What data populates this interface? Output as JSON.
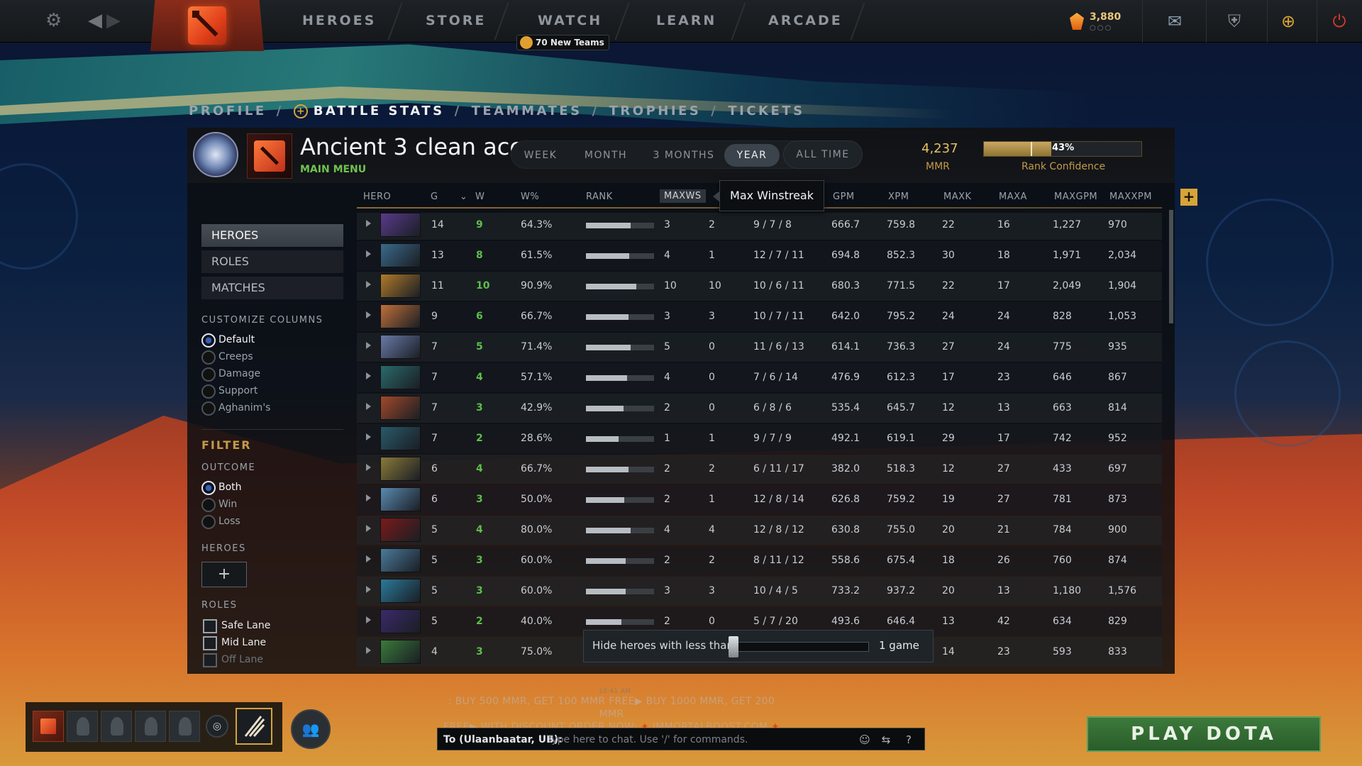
{
  "nav": {
    "items": [
      "HEROES",
      "STORE",
      "WATCH",
      "LEARN",
      "ARCADE"
    ],
    "notification": "70 New Teams",
    "shards": "3,880",
    "shards_sub": "○○○"
  },
  "breadcrumb": {
    "profile": "PROFILE",
    "battle_stats": "BATTLE STATS",
    "teammates": "TEAMMATES",
    "trophies": "TROPHIES",
    "tickets": "TICKETS",
    "sep": "/"
  },
  "profile": {
    "name": "Ancient 3 clean acc",
    "subtitle": "MAIN MENU"
  },
  "timeframe": {
    "options": [
      "WEEK",
      "MONTH",
      "3 MONTHS",
      "YEAR"
    ],
    "selected": "YEAR",
    "all_time": "ALL TIME"
  },
  "mmr": {
    "value": "4,237",
    "label": "MMR"
  },
  "rank_confidence": {
    "percent_label": "43%",
    "fraction": 0.43,
    "label": "Rank Confidence"
  },
  "columns": [
    "HERO",
    "G",
    "W",
    "W%",
    "RANK",
    "MAXWS",
    "GPM",
    "XPM",
    "MAXK",
    "MAXA",
    "MAXGPM",
    "MAXXPM"
  ],
  "tooltip": "Max Winstreak",
  "sidebar": {
    "tabs": [
      "HEROES",
      "ROLES",
      "MATCHES"
    ],
    "customize_title": "CUSTOMIZE COLUMNS",
    "customize_options": [
      "Default",
      "Creeps",
      "Damage",
      "Support",
      "Aghanim's"
    ],
    "filter_title": "FILTER",
    "outcome_title": "OUTCOME",
    "outcome_options": [
      "Both",
      "Win",
      "Loss"
    ],
    "heroes_title": "HEROES",
    "hero_add": "+",
    "roles_title": "ROLES",
    "roles": [
      "Safe Lane",
      "Mid Lane",
      "Off Lane"
    ]
  },
  "rows": [
    {
      "g": "14",
      "w": "9",
      "wp": "64.3%",
      "rank": 0.66,
      "maxws": "3",
      "cur": "2",
      "kda": "9 / 7 / 8",
      "gpm": "666.7",
      "xpm": "759.8",
      "maxk": "22",
      "maxa": "16",
      "maxgpm": "1,227",
      "maxxpm": "970",
      "color": "#5a3a8a"
    },
    {
      "g": "13",
      "w": "8",
      "wp": "61.5%",
      "rank": 0.64,
      "maxws": "4",
      "cur": "1",
      "kda": "12 / 7 / 11",
      "gpm": "694.8",
      "xpm": "852.3",
      "maxk": "30",
      "maxa": "18",
      "maxgpm": "1,971",
      "maxxpm": "2,034",
      "color": "#3a6a8a"
    },
    {
      "g": "11",
      "w": "10",
      "wp": "90.9%",
      "rank": 0.74,
      "maxws": "10",
      "cur": "10",
      "kda": "10 / 6 / 11",
      "gpm": "680.3",
      "xpm": "771.5",
      "maxk": "22",
      "maxa": "17",
      "maxgpm": "2,049",
      "maxxpm": "1,904",
      "color": "#b07a2a"
    },
    {
      "g": "9",
      "w": "6",
      "wp": "66.7%",
      "rank": 0.62,
      "maxws": "3",
      "cur": "3",
      "kda": "10 / 7 / 11",
      "gpm": "642.0",
      "xpm": "795.2",
      "maxk": "24",
      "maxa": "24",
      "maxgpm": "828",
      "maxxpm": "1,053",
      "color": "#c0703a"
    },
    {
      "g": "7",
      "w": "5",
      "wp": "71.4%",
      "rank": 0.66,
      "maxws": "5",
      "cur": "0",
      "kda": "11 / 6 / 13",
      "gpm": "614.1",
      "xpm": "736.3",
      "maxk": "27",
      "maxa": "24",
      "maxgpm": "775",
      "maxxpm": "935",
      "color": "#6a7aa8"
    },
    {
      "g": "7",
      "w": "4",
      "wp": "57.1%",
      "rank": 0.6,
      "maxws": "4",
      "cur": "0",
      "kda": "7 / 6 / 14",
      "gpm": "476.9",
      "xpm": "612.3",
      "maxk": "17",
      "maxa": "23",
      "maxgpm": "646",
      "maxxpm": "867",
      "color": "#2a6a6a"
    },
    {
      "g": "7",
      "w": "3",
      "wp": "42.9%",
      "rank": 0.55,
      "maxws": "2",
      "cur": "0",
      "kda": "6 / 8 / 6",
      "gpm": "535.4",
      "xpm": "645.7",
      "maxk": "12",
      "maxa": "13",
      "maxgpm": "663",
      "maxxpm": "814",
      "color": "#a04a2a"
    },
    {
      "g": "7",
      "w": "2",
      "wp": "28.6%",
      "rank": 0.48,
      "maxws": "1",
      "cur": "1",
      "kda": "9 / 7 / 9",
      "gpm": "492.1",
      "xpm": "619.1",
      "maxk": "29",
      "maxa": "17",
      "maxgpm": "742",
      "maxxpm": "952",
      "color": "#2a5a6a"
    },
    {
      "g": "6",
      "w": "4",
      "wp": "66.7%",
      "rank": 0.62,
      "maxws": "2",
      "cur": "2",
      "kda": "6 / 11 / 17",
      "gpm": "382.0",
      "xpm": "518.3",
      "maxk": "12",
      "maxa": "27",
      "maxgpm": "433",
      "maxxpm": "697",
      "color": "#8a7a3a"
    },
    {
      "g": "6",
      "w": "3",
      "wp": "50.0%",
      "rank": 0.56,
      "maxws": "2",
      "cur": "1",
      "kda": "12 / 8 / 14",
      "gpm": "626.8",
      "xpm": "759.2",
      "maxk": "19",
      "maxa": "27",
      "maxgpm": "781",
      "maxxpm": "873",
      "color": "#5a8ab0"
    },
    {
      "g": "5",
      "w": "4",
      "wp": "80.0%",
      "rank": 0.66,
      "maxws": "4",
      "cur": "4",
      "kda": "12 / 8 / 12",
      "gpm": "630.8",
      "xpm": "755.0",
      "maxk": "20",
      "maxa": "21",
      "maxgpm": "784",
      "maxxpm": "900",
      "color": "#7a1a1a"
    },
    {
      "g": "5",
      "w": "3",
      "wp": "60.0%",
      "rank": 0.58,
      "maxws": "2",
      "cur": "2",
      "kda": "8 / 11 / 12",
      "gpm": "558.6",
      "xpm": "675.4",
      "maxk": "18",
      "maxa": "26",
      "maxgpm": "760",
      "maxxpm": "874",
      "color": "#4a7a9a"
    },
    {
      "g": "5",
      "w": "3",
      "wp": "60.0%",
      "rank": 0.58,
      "maxws": "3",
      "cur": "3",
      "kda": "10 / 4 / 5",
      "gpm": "733.2",
      "xpm": "937.2",
      "maxk": "20",
      "maxa": "13",
      "maxgpm": "1,180",
      "maxxpm": "1,576",
      "color": "#2a7a9a"
    },
    {
      "g": "5",
      "w": "2",
      "wp": "40.0%",
      "rank": 0.52,
      "maxws": "2",
      "cur": "0",
      "kda": "5 / 7 / 20",
      "gpm": "493.6",
      "xpm": "646.4",
      "maxk": "13",
      "maxa": "42",
      "maxgpm": "634",
      "maxxpm": "829",
      "color": "#3a2a6a"
    },
    {
      "g": "4",
      "w": "3",
      "wp": "75.0%",
      "rank": 0.6,
      "maxws": "",
      "cur": "",
      "kda": "",
      "gpm": "",
      "xpm": "",
      "maxk": "14",
      "maxa": "23",
      "maxgpm": "593",
      "maxxpm": "833",
      "color": "#3a7a3a"
    }
  ],
  "slider": {
    "label": "Hide heroes with less than:",
    "value": "1 game"
  },
  "ad": {
    "time": "10:41 AM",
    "line1": ": BUY 500 MMR, GET 100 MMR FREE▶ BUY 1000 MMR, GET 200 MMR",
    "line2": "FREE▶ WITH DISCOUNT ORDER NOW: ",
    "link": " IMMORTALBOOST.COM "
  },
  "chat": {
    "to": "To (Ulaanbaatar, UB):",
    "placeholder": "Type here to chat. Use '/' for commands.",
    "help": "?"
  },
  "play_button": "PLAY DOTA",
  "colors": {
    "accent_gold": "#d6a437",
    "win_green": "#5cbf4a",
    "play_green": "#3c7a3c"
  }
}
